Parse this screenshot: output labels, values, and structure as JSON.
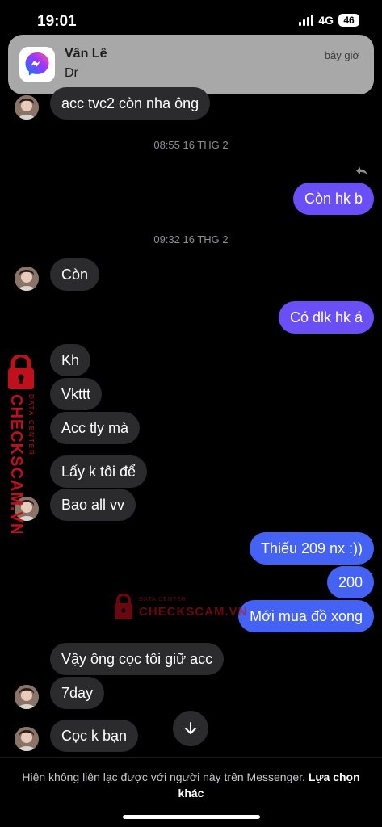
{
  "status": {
    "time": "19:01",
    "network": "4G",
    "battery": "46"
  },
  "notification": {
    "app_icon": "messenger-icon",
    "sender": "Vân Lê",
    "message": "Dr",
    "time": "bây giờ"
  },
  "conversation": {
    "messages": [
      {
        "id": 0,
        "dir": "in",
        "text": "acc tvc2 còn nha ông"
      },
      {
        "id": 1,
        "dir": "ts",
        "text": "08:55 16 THG 2"
      },
      {
        "id": 2,
        "dir": "out",
        "text": "Còn hk b"
      },
      {
        "id": 3,
        "dir": "ts",
        "text": "09:32 16 THG 2"
      },
      {
        "id": 4,
        "dir": "in",
        "text": "Còn"
      },
      {
        "id": 5,
        "dir": "out",
        "text": "Có dlk hk á"
      },
      {
        "id": 6,
        "dir": "in",
        "text": "Kh"
      },
      {
        "id": 7,
        "dir": "in",
        "text": "Vkttt"
      },
      {
        "id": 8,
        "dir": "in",
        "text": "Acc tly mà"
      },
      {
        "id": 9,
        "dir": "in",
        "text": "Lấy k tôi để"
      },
      {
        "id": 10,
        "dir": "in",
        "text": "Bao all vv"
      },
      {
        "id": 11,
        "dir": "out",
        "text": "Thiếu 209 nx :))"
      },
      {
        "id": 12,
        "dir": "out",
        "text": "200"
      },
      {
        "id": 13,
        "dir": "out",
        "text": "Mới mua đồ xong"
      },
      {
        "id": 14,
        "dir": "in",
        "text": "Vậy ông cọc tôi giữ acc"
      },
      {
        "id": 15,
        "dir": "in",
        "text": "7day"
      },
      {
        "id": 16,
        "dir": "in",
        "text": "Cọc k bạn"
      }
    ]
  },
  "watermark": {
    "brand": "CHECKSCAM.VN",
    "tagline": "DATA CENTER"
  },
  "footer": {
    "notice": "Hiện không liên lạc được với người này trên Messenger.",
    "link": "Lựa chọn khác"
  },
  "colors": {
    "outgoing": "#6b4ff6",
    "outgoing_blue": "#4463f5",
    "incoming": "#2b2b2d",
    "watermark": "#c0101c"
  }
}
